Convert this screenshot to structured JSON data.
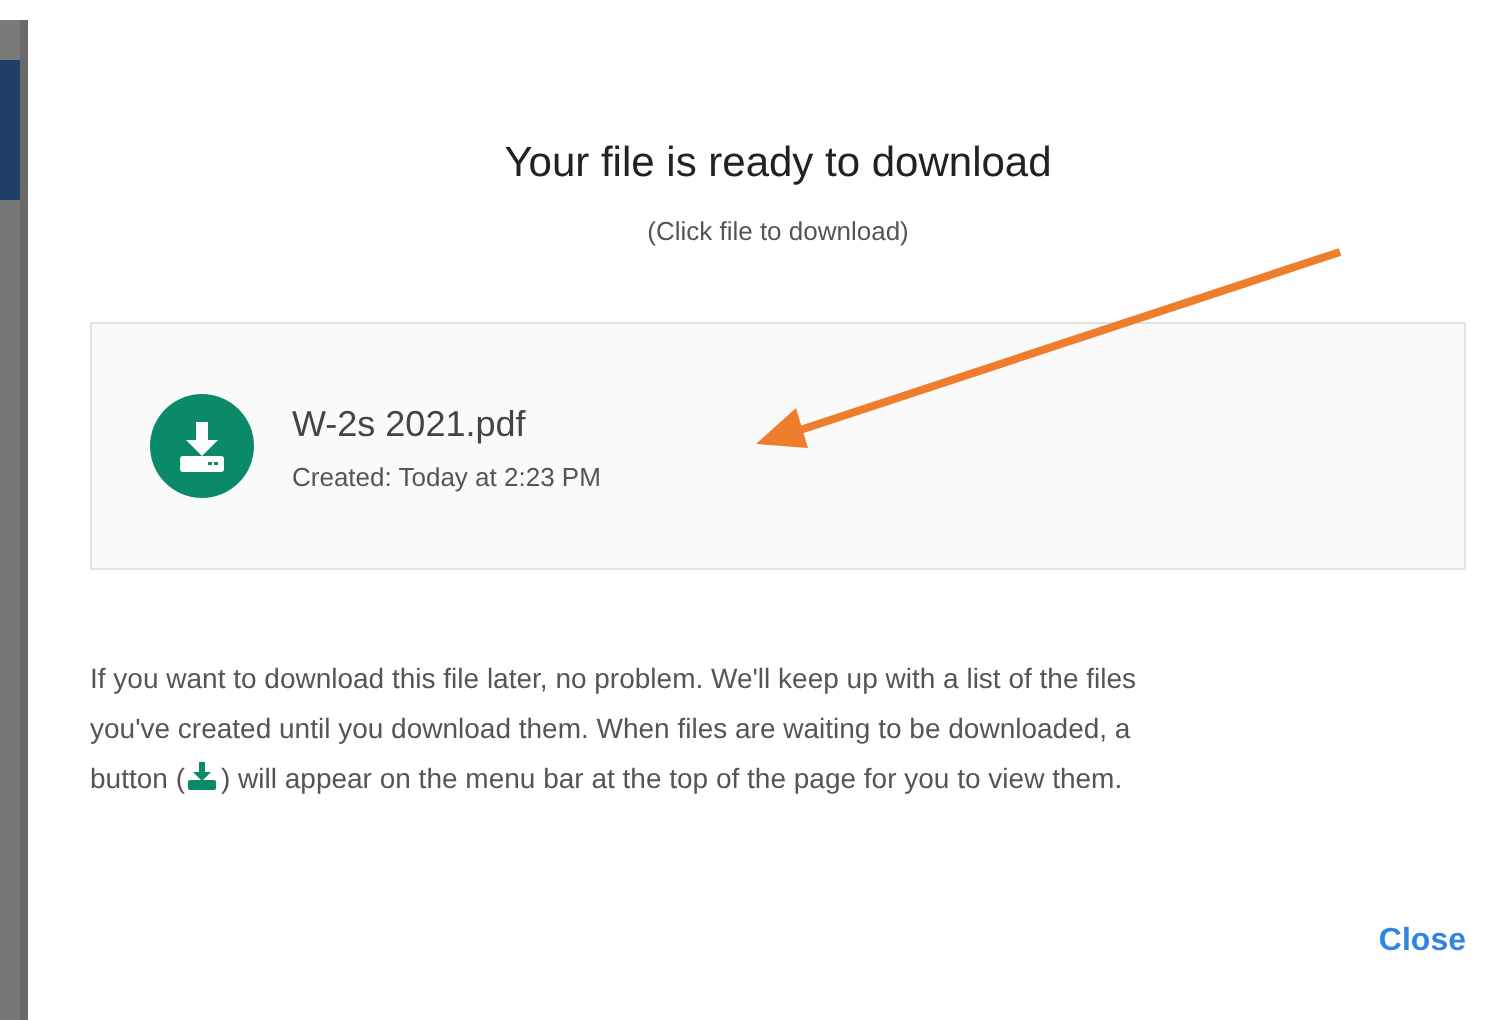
{
  "dialog": {
    "title": "Your file is ready to download",
    "subtitle": "(Click file to download)",
    "file": {
      "name": "W-2s 2021.pdf",
      "created": "Created: Today at 2:23 PM"
    },
    "message": {
      "lines": [
        "If you want to download this file later, no problem. We'll keep up with a list of the files",
        "you've created until you download them. When files are waiting to be downloaded, a"
      ],
      "before": "button (",
      "after": ") will appear on the menu bar at the top of the page for you to view them."
    },
    "buttons": [
      "Close"
    ]
  }
}
